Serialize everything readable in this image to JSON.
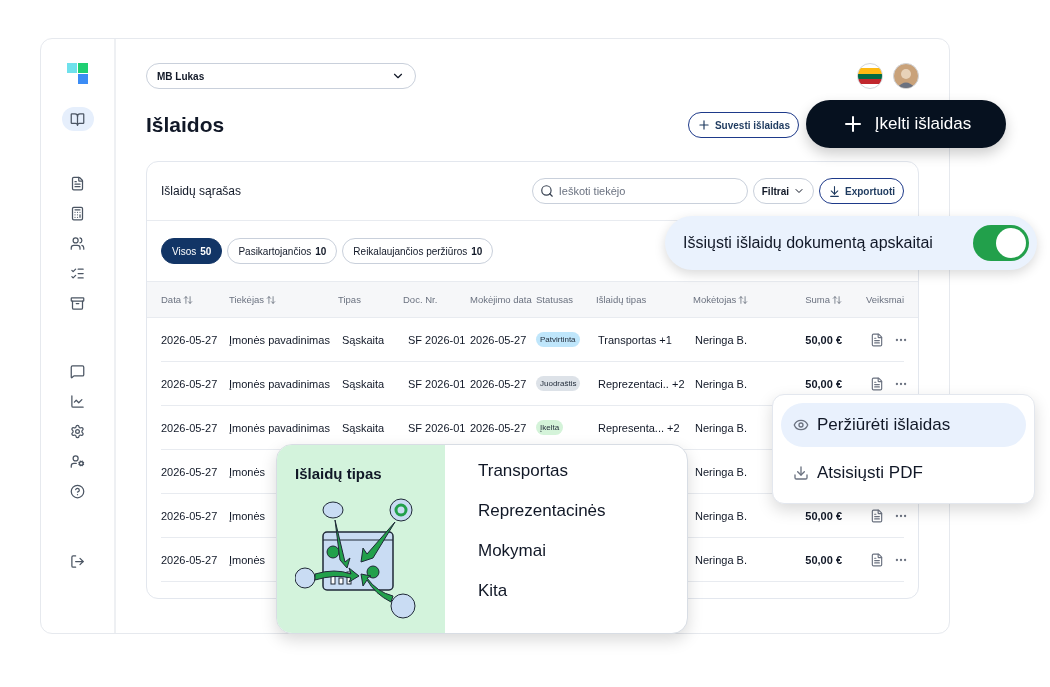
{
  "company_select": {
    "value": "MB Lukas"
  },
  "page_title": "Išlaidos",
  "buttons": {
    "add": "Suvesti išlaidas",
    "upload": "Įkelti išlaidas"
  },
  "card": {
    "title": "Išlaidų sąrašas",
    "search": {
      "placeholder": "Ieškoti tiekėjo"
    },
    "filter": "Filtrai",
    "export": "Exportuoti"
  },
  "tabs": [
    {
      "label": "Visos",
      "count": "50",
      "selected": true
    },
    {
      "label": "Pasikartojančios",
      "count": "10",
      "selected": false
    },
    {
      "label": "Reikalaujančios peržiūros",
      "count": "10",
      "selected": false
    }
  ],
  "table": {
    "columns": [
      {
        "label": "Data",
        "sortable": true
      },
      {
        "label": "Tiekėjas",
        "sortable": true
      },
      {
        "label": "Tipas",
        "sortable": false
      },
      {
        "label": "Doc. Nr.",
        "sortable": false
      },
      {
        "label": "Mokėjimo data",
        "sortable": false
      },
      {
        "label": "Statusas",
        "sortable": false
      },
      {
        "label": "Išlaidų tipas",
        "sortable": false
      },
      {
        "label": "Mokėtojas",
        "sortable": true
      },
      {
        "label": "Suma",
        "sortable": true
      },
      {
        "label": "Veiksmai",
        "sortable": false
      }
    ],
    "rows": [
      {
        "date": "2026-05-27",
        "supplier": "Įmonės pavadinimas",
        "type": "Sąskaita",
        "doc": "SF 2026-01",
        "pay_date": "2026-05-27",
        "status": {
          "label": "Patvirtinta",
          "color": "#bfe6fb"
        },
        "category": "Transportas +1",
        "payer": "Neringa B.",
        "sum": "50,00 €",
        "actions": true
      },
      {
        "date": "2026-05-27",
        "supplier": "Įmonės pavadinimas",
        "type": "Sąskaita",
        "doc": "SF 2026-01",
        "pay_date": "2026-05-27",
        "status": {
          "label": "Juodraštis",
          "color": "#dde2e8"
        },
        "category": "Reprezentaci.. +2",
        "payer": "Neringa B.",
        "sum": "50,00 €",
        "actions": true
      },
      {
        "date": "2026-05-27",
        "supplier": "Įmonės pavadinimas",
        "type": "Sąskaita",
        "doc": "SF 2026-01",
        "pay_date": "2026-05-27",
        "status": {
          "label": "Įkelta",
          "color": "#d4f3d9"
        },
        "category": "Representa... +2",
        "payer": "Neringa B.",
        "actions": false
      },
      {
        "date": "2026-05-27",
        "supplier": "Įmonės",
        "payer": "Neringa B.",
        "actions": false
      },
      {
        "date": "2026-05-27",
        "supplier": "Įmonės",
        "payer": "Neringa B.",
        "sum": "50,00 €",
        "actions": true
      },
      {
        "date": "2026-05-27",
        "supplier": "Įmonės",
        "payer": "Neringa B.",
        "sum": "50,00 €",
        "actions": true
      }
    ]
  },
  "send_toggle": {
    "label": "Išsiųsti išlaidų dokumentą apskaitai",
    "on": true
  },
  "category_popup": {
    "title": "Išlaidų tipas",
    "items": [
      "Transportas",
      "Reprezentacinės",
      "Mokymai",
      "Kita"
    ]
  },
  "row_menu": {
    "items": [
      {
        "kind": "view",
        "label": "Peržiūrėti išlaidas",
        "selected": true
      },
      {
        "kind": "download",
        "label": "Atsisiųsti PDF",
        "selected": false
      }
    ]
  }
}
